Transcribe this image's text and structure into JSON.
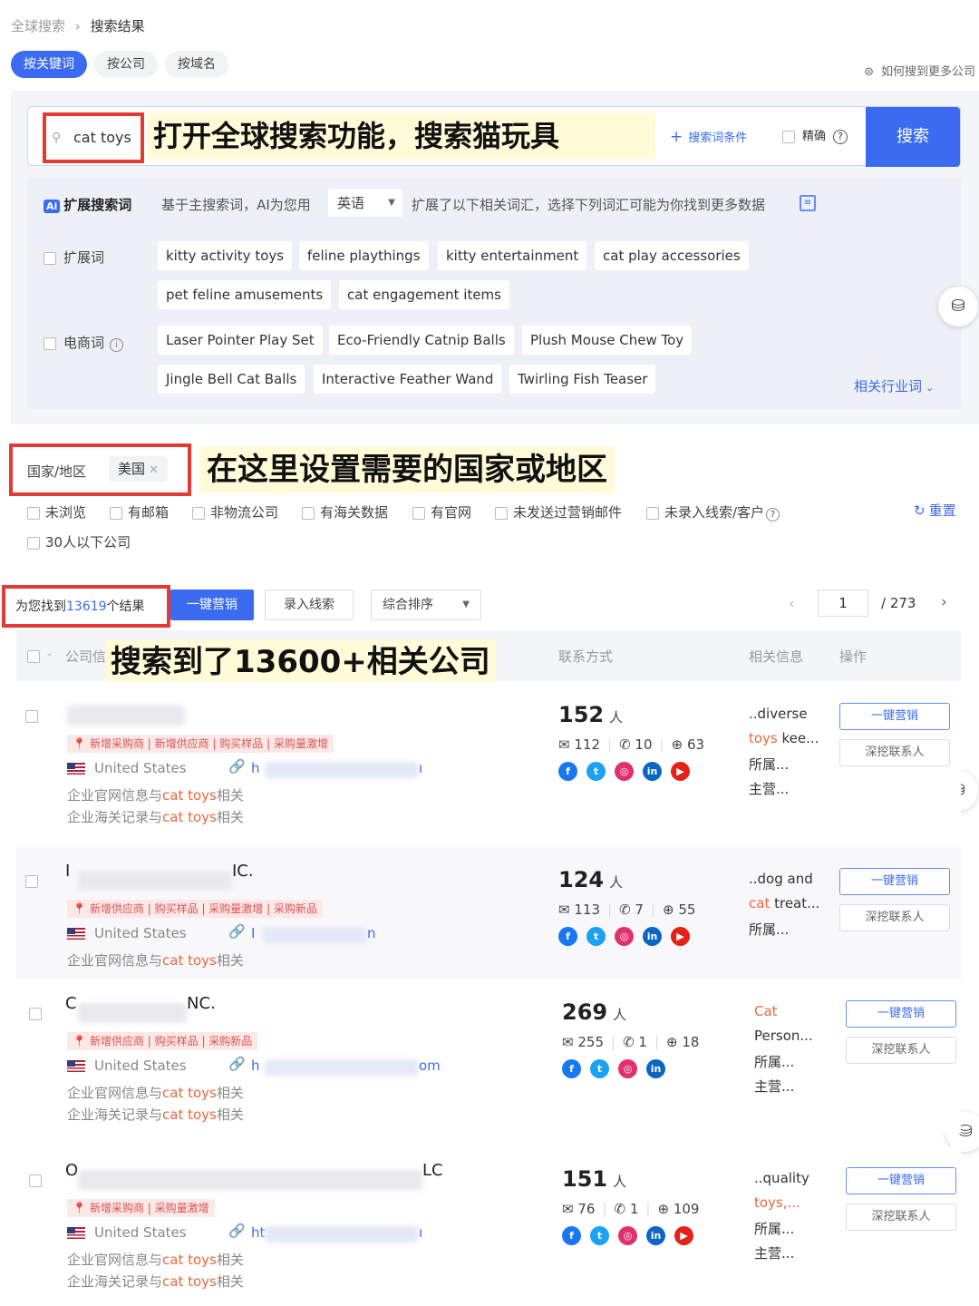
{
  "breadcrumb": {
    "root": "全球搜索",
    "sep": "›",
    "current": "搜索结果"
  },
  "mode_tabs": [
    "按关键词",
    "按公司",
    "按域名"
  ],
  "help_link": "如何搜到更多公司",
  "search": {
    "value": "cat toys",
    "conditions_label": "搜索词条件",
    "exact_label": "精确",
    "button": "搜索",
    "annotation": "打开全球搜索功能，搜索猫玩具"
  },
  "expansion": {
    "badge": "Ai",
    "title": "扩展搜索词",
    "desc_prefix": "基于主搜索词，AI为您用",
    "language": "英语",
    "desc_suffix": "扩展了以下相关词汇，选择下列词汇可能为你找到更多数据",
    "expand_label": "扩展词",
    "expand_words": [
      "kitty activity toys",
      "feline playthings",
      "kitty entertainment",
      "cat play accessories",
      "pet feline amusements",
      "cat engagement items"
    ],
    "ecom_label": "电商词",
    "ecom_words": [
      "Laser Pointer Play Set",
      "Eco-Friendly Catnip Balls",
      "Plush Mouse Chew Toy",
      "Jingle Bell Cat Balls",
      "Interactive Feather Wand",
      "Twirling Fish Teaser"
    ],
    "industry_link": "相关行业词"
  },
  "filters": {
    "country_label": "国家/地区",
    "country_value": "美国",
    "annotation": "在这里设置需要的国家或地区",
    "checks": [
      "未浏览",
      "有邮箱",
      "非物流公司",
      "有海关数据",
      "有官网",
      "未发送过营销邮件",
      "未录入线索/客户"
    ],
    "check_extra": "30人以下公司",
    "reset": "重置"
  },
  "results": {
    "count_prefix": "为您找到",
    "count": "13619",
    "count_suffix": "个结果",
    "btn_market": "一键营销",
    "btn_lead": "录入线索",
    "sort": "综合排序",
    "page": "1",
    "total_pages": "/ 273",
    "annotation": "搜索到了13600+相关公司"
  },
  "table_headers": {
    "company": "公司信",
    "contact": "联系方式",
    "related": "相关信息",
    "action": "操作"
  },
  "rows": [
    {
      "name_tail": "",
      "tags": "新增采购商 | 新增供应商 | 购买样品 | 采购量激增",
      "country": "United States",
      "url_head": "h",
      "url_tail": "ı",
      "line1a": "企业官网信息与",
      "kw": "cat toys",
      "line_end": "相关",
      "line2a": "企业海关记录与",
      "people": "152",
      "unit": "人",
      "emails": "112",
      "wa": "10",
      "web": "63",
      "rel": [
        "..diverse",
        "toys kee...",
        "所属...",
        "主营..."
      ],
      "rel_hl": "toys",
      "rel_rest": " kee...",
      "btn1": "一键营销",
      "btn2": "深挖联系人"
    },
    {
      "name_head": "I",
      "name_tail": "IC.",
      "tags": "新增供应商 | 购买样品 | 采购量激增 | 采购新品",
      "country": "United States",
      "url_head": "I",
      "url_tail": "n",
      "line1a": "企业官网信息与",
      "kw": "cat toys",
      "line_end": "相关",
      "line2a": "企业海关记录与",
      "people": "124",
      "unit": "人",
      "emails": "113",
      "wa": "7",
      "web": "55",
      "rel": [
        "..dog and",
        "cat treat...",
        "所属..."
      ],
      "rel_hl": "cat",
      "rel_rest": " treat...",
      "btn1": "一键营销",
      "btn2": "深挖联系人"
    },
    {
      "name_head": "C",
      "name_tail": "NC.",
      "tags": "新增供应商 | 购买样品 | 采购新品",
      "country": "United States",
      "url_head": "h",
      "url_tail": "om",
      "line1a": "企业官网信息与",
      "kw": "cat toys",
      "line_end": "相关",
      "line2a": "企业海关记录与",
      "people": "269",
      "unit": "人",
      "emails": "255",
      "wa": "1",
      "web": "18",
      "rel": [
        "Cat",
        "Person...",
        "所属...",
        "主营..."
      ],
      "rel_hl": "Cat",
      "btn1": "一键营销",
      "btn2": "深挖联系人"
    },
    {
      "name_head": "O",
      "name_tail": "LC",
      "tags": "新增采购商 | 采购量激增",
      "country": "United States",
      "url_head": "ht",
      "url_tail": "ı",
      "line1a": "企业官网信息与",
      "kw": "cat toys",
      "line_end": "相关",
      "line2a": "企业海关记录与",
      "people": "151",
      "unit": "人",
      "emails": "76",
      "wa": "1",
      "web": "109",
      "rel": [
        "..quality",
        "toys,...",
        "所属...",
        "主营..."
      ],
      "rel_hl": "toys,...",
      "btn1": "一键营销",
      "btn2": "深挖联系人"
    }
  ],
  "colors": {
    "accent": "#3b6bf0",
    "annotation_red": "#e53935",
    "highlight": "#e8683c"
  }
}
